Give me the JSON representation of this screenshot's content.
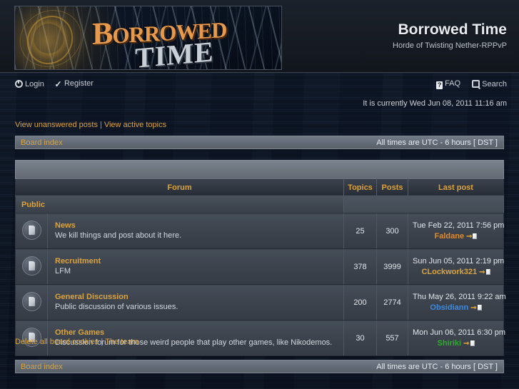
{
  "header": {
    "logo_word1": "B",
    "logo_word1_rest": "ORROWED",
    "logo_word2": "TIME",
    "site_title": "Borrowed Time",
    "site_description": "Horde of Twisting Nether-RPPvP"
  },
  "nav": {
    "left": [
      {
        "label": "Login",
        "icon": "power-icon"
      },
      {
        "label": "Register",
        "icon": "check-icon"
      }
    ],
    "right": [
      {
        "label": "FAQ",
        "icon": "question-mark-icon"
      },
      {
        "label": "Search",
        "icon": "magnifier-icon"
      }
    ]
  },
  "current_time": "It is currently Wed Jun 08, 2011 11:16 am",
  "quicklinks": {
    "unanswered": "View unanswered posts",
    "separator": "|",
    "active": "View active topics"
  },
  "navbar": {
    "board_index": "Board index",
    "timezone": "All times are UTC - 6 hours [ DST ]"
  },
  "table": {
    "headers": {
      "forum": "Forum",
      "topics": "Topics",
      "posts": "Posts",
      "last_post": "Last post"
    },
    "category": "Public",
    "rows": [
      {
        "title": "News",
        "description": "We kill things and post about it here.",
        "topics": "25",
        "posts": "300",
        "last_post_date": "Tue Feb 22, 2011 7:56 pm",
        "last_post_user": "Faldane",
        "last_post_user_color": "#e08a2a"
      },
      {
        "title": "Recruitment",
        "description": "LFM",
        "topics": "378",
        "posts": "3999",
        "last_post_date": "Sun Jun 05, 2011 2:19 pm",
        "last_post_user": "CLockwork321",
        "last_post_user_color": "#d9a441"
      },
      {
        "title": "General Discussion",
        "description": "Public discussion of various issues.",
        "topics": "200",
        "posts": "2774",
        "last_post_date": "Thu May 26, 2011 9:22 am",
        "last_post_user": "Obsidiann",
        "last_post_user_color": "#3c8ae0"
      },
      {
        "title": "Other Games",
        "description": "Discussion forum for those weird people that play other games, like Nikodemos.",
        "topics": "30",
        "posts": "557",
        "last_post_date": "Mon Jun 06, 2011 6:30 pm",
        "last_post_user": "Shiriki",
        "last_post_user_color": "#2faa2f"
      }
    ]
  },
  "footer": {
    "delete_cookies": "Delete all board cookies",
    "separator": "|",
    "the_team": "The team"
  },
  "colors": {
    "accent": "#d9a441",
    "link": "#d9a441",
    "background": "#0b1524"
  }
}
